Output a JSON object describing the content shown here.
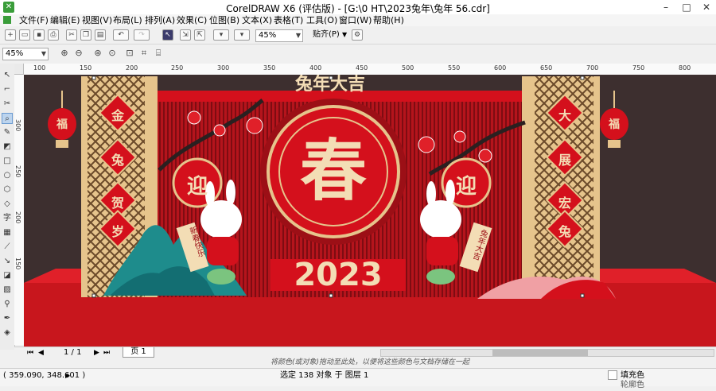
{
  "window": {
    "title": "CorelDRAW X6 (评估版) - [G:\\0 HT\\2023兔年\\兔年 56.cdr]",
    "logo_glyph": "✕",
    "controls": [
      "–",
      "□",
      "✕"
    ]
  },
  "menubar": {
    "items": [
      "文件(F)",
      "编辑(E)",
      "视图(V)",
      "布局(L)",
      "排列(A)",
      "效果(C)",
      "位图(B)",
      "文本(X)",
      "表格(T)",
      "工具(O)",
      "窗口(W)",
      "帮助(H)"
    ]
  },
  "toolbar1": {
    "zoom_value": "45%",
    "snap_label": "贴齐(P)"
  },
  "toolbar2": {
    "zoom_value": "45%"
  },
  "ruler": {
    "h_ticks": [
      "100",
      "150",
      "200",
      "250",
      "300",
      "350",
      "400",
      "450",
      "500",
      "550",
      "600",
      "650",
      "700",
      "750",
      "800"
    ],
    "v_ticks": [
      "300",
      "250",
      "200",
      "150"
    ]
  },
  "artwork": {
    "top_banner": "兔年大吉",
    "center_char": "春",
    "year": "2023",
    "left_couplet": [
      "金",
      "兔",
      "贺",
      "岁"
    ],
    "right_couplet": [
      "大",
      "展",
      "宏",
      "兔"
    ],
    "lantern_char": "福",
    "left_disc_char": "迎",
    "right_disc_char": "迎",
    "left_scroll": "新春快乐",
    "right_scroll": "兔年大吉",
    "colors": {
      "red": "#d4101c",
      "dark_red": "#9c0f16",
      "gold": "#e6c48c",
      "floor": "#c8161d",
      "wall": "#3d2f2f",
      "teal": "#1e8c8c"
    }
  },
  "pagebar": {
    "page_counter": "1 / 1",
    "page_tab": "页 1"
  },
  "hint": "将颜色(或对象)拖动至此处，以便将这些颜色与文档存储在一起",
  "statusbar": {
    "coords": "( 359.090, 348.601 )",
    "selection": "选定 138 对象 于 图层 1",
    "fill_label": "填充色",
    "outline_label": "轮廓色"
  }
}
